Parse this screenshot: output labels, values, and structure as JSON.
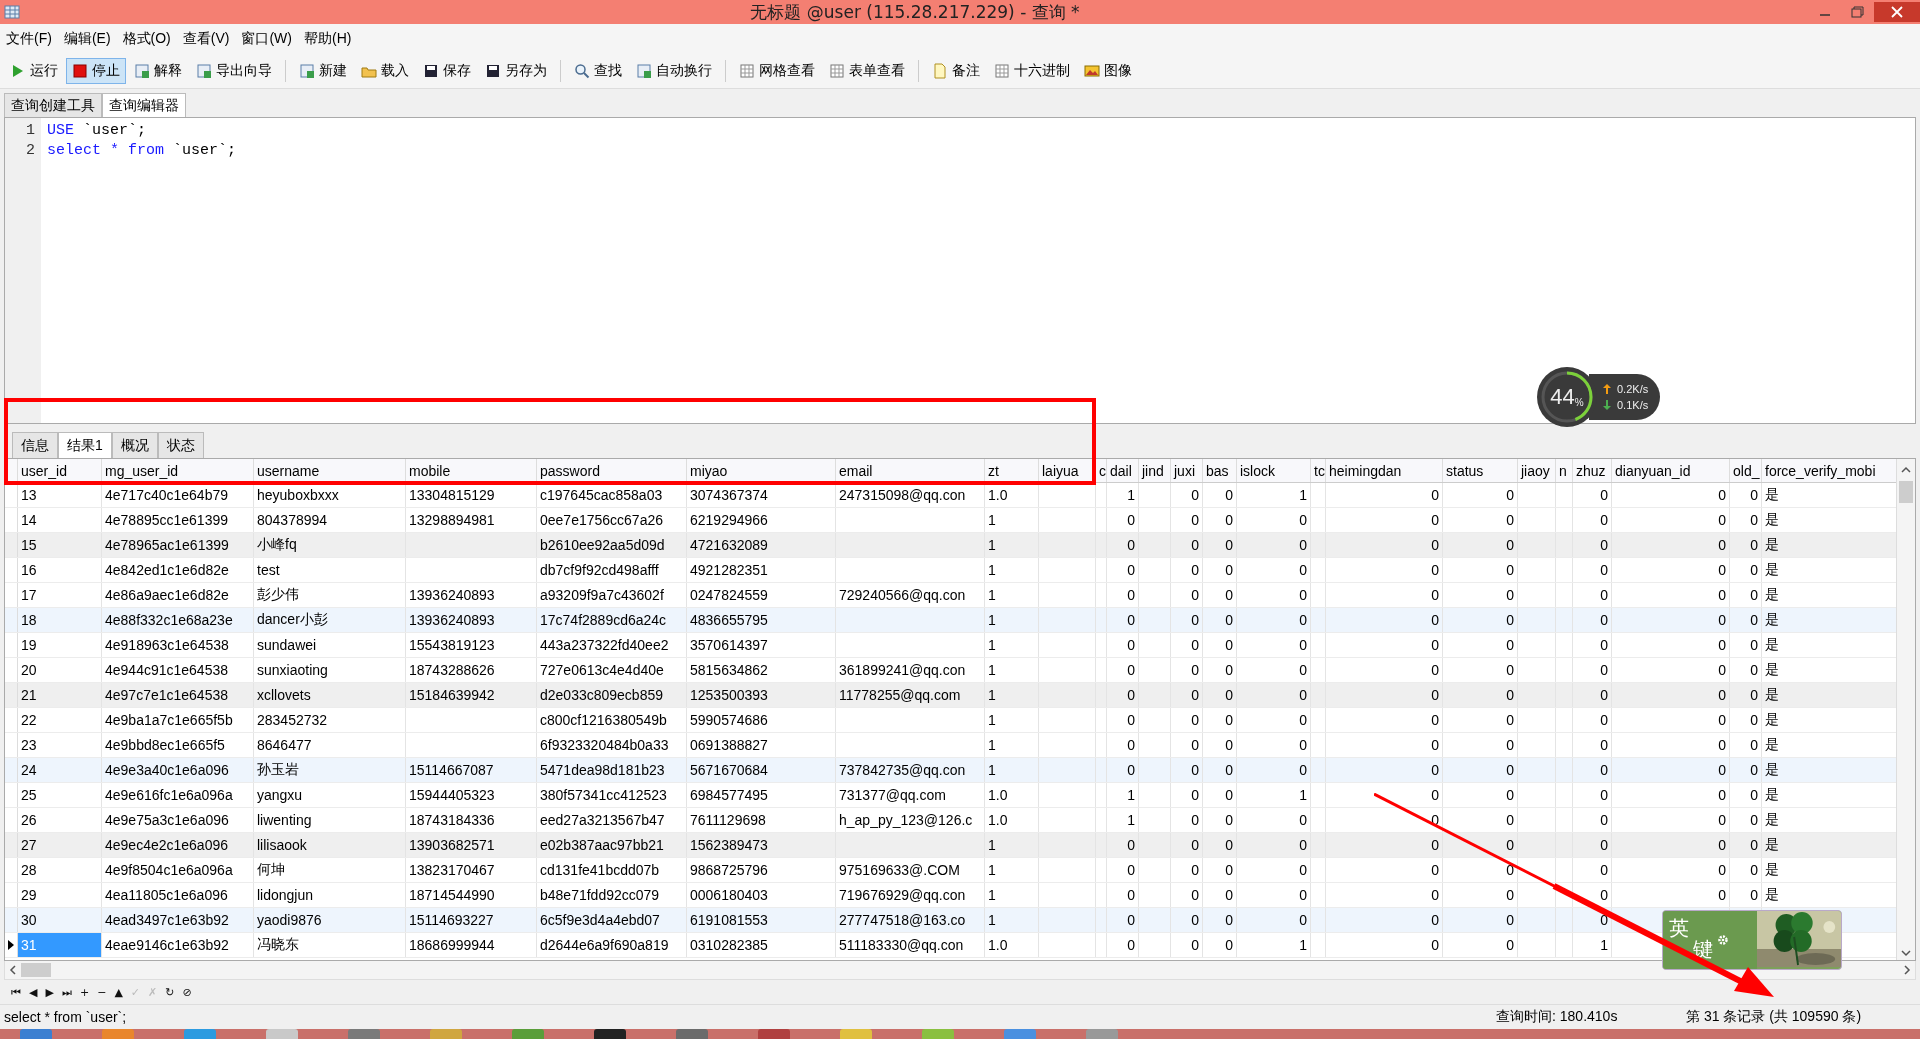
{
  "window": {
    "title": "无标题 @user (115.28.217.229) - 查询 *"
  },
  "menu": [
    "文件(F)",
    "编辑(E)",
    "格式(O)",
    "查看(V)",
    "窗口(W)",
    "帮助(H)"
  ],
  "toolbar": [
    [
      {
        "label": "运行",
        "selected": false
      },
      {
        "label": "停止",
        "selected": true
      },
      {
        "label": "解释",
        "selected": false
      },
      {
        "label": "导出向导",
        "selected": false
      }
    ],
    [
      {
        "label": "新建",
        "selected": false
      },
      {
        "label": "载入",
        "selected": false
      },
      {
        "label": "保存",
        "selected": false
      },
      {
        "label": "另存为",
        "selected": false
      }
    ],
    [
      {
        "label": "查找",
        "selected": false
      },
      {
        "label": "自动换行",
        "selected": false
      }
    ],
    [
      {
        "label": "网格查看",
        "selected": false
      },
      {
        "label": "表单查看",
        "selected": false
      }
    ],
    [
      {
        "label": "备注",
        "selected": false
      },
      {
        "label": "十六进制",
        "selected": false
      },
      {
        "label": "图像",
        "selected": false
      }
    ]
  ],
  "editor_tabs": [
    {
      "label": "查询创建工具",
      "selected": false
    },
    {
      "label": "查询编辑器",
      "selected": true
    }
  ],
  "editor": {
    "lines": [
      {
        "number": "1",
        "tokens": [
          {
            "text": "USE",
            "kind": "keyword"
          },
          {
            "text": " `user`;",
            "kind": "plain"
          }
        ]
      },
      {
        "number": "2",
        "tokens": [
          {
            "text": "select * from",
            "kind": "keyword"
          },
          {
            "text": " `user`;",
            "kind": "plain"
          }
        ]
      }
    ]
  },
  "result_tabs": [
    {
      "label": "信息",
      "selected": false
    },
    {
      "label": "结果1",
      "selected": true
    },
    {
      "label": "概况",
      "selected": false
    },
    {
      "label": "状态",
      "selected": false
    }
  ],
  "table": {
    "columns": [
      {
        "label": "user_id",
        "kind": "text"
      },
      {
        "label": "mg_user_id",
        "kind": "text"
      },
      {
        "label": "username",
        "kind": "text"
      },
      {
        "label": "mobile",
        "kind": "text"
      },
      {
        "label": "password",
        "kind": "text"
      },
      {
        "label": "miyao",
        "kind": "text"
      },
      {
        "label": "email",
        "kind": "text"
      },
      {
        "label": "zt",
        "kind": "text"
      },
      {
        "label": "laiyua",
        "kind": "text"
      },
      {
        "label": "c",
        "kind": "text"
      },
      {
        "label": "dail",
        "kind": "number"
      },
      {
        "label": "jind",
        "kind": "number"
      },
      {
        "label": "juxi",
        "kind": "number"
      },
      {
        "label": "bas",
        "kind": "number"
      },
      {
        "label": "islock",
        "kind": "number"
      },
      {
        "label": "tc",
        "kind": "number"
      },
      {
        "label": "heimingdan",
        "kind": "number"
      },
      {
        "label": "status",
        "kind": "number"
      },
      {
        "label": "jiaoy",
        "kind": "text"
      },
      {
        "label": "n",
        "kind": "text"
      },
      {
        "label": "zhuz",
        "kind": "number"
      },
      {
        "label": "dianyuan_id",
        "kind": "number"
      },
      {
        "label": "old_",
        "kind": "number"
      },
      {
        "label": "force_verify_mobi",
        "kind": "text"
      }
    ],
    "rows": [
      {
        "selected": false,
        "cells": [
          "13",
          "4e717c40c1e64b79",
          "heyuboxbxxx",
          "13304815129",
          "c197645cac858a03",
          "3074367374",
          "247315098@qq.con",
          "1.0",
          null,
          null,
          "1",
          null,
          "0",
          "0",
          "1",
          null,
          "0",
          "0",
          null,
          null,
          "0",
          "0",
          "0",
          "是"
        ]
      },
      {
        "selected": false,
        "cells": [
          "14",
          "4e78895cc1e61399",
          "804378994",
          "13298894981",
          "0ee7e1756cc67a26",
          "6219294966",
          null,
          "1",
          null,
          null,
          "0",
          null,
          "0",
          "0",
          "0",
          null,
          "0",
          "0",
          null,
          null,
          "0",
          "0",
          "0",
          "是"
        ]
      },
      {
        "selected": false,
        "cells": [
          "15",
          "4e78965ac1e61399",
          "小峰fq",
          null,
          "b2610ee92aa5d09d",
          "4721632089",
          null,
          "1",
          null,
          null,
          "0",
          null,
          "0",
          "0",
          "0",
          null,
          "0",
          "0",
          null,
          null,
          "0",
          "0",
          "0",
          "是"
        ]
      },
      {
        "selected": false,
        "cells": [
          "16",
          "4e842ed1c1e6d82e",
          "test",
          null,
          "db7cf9f92cd498afff",
          "4921282351",
          null,
          "1",
          null,
          null,
          "0",
          null,
          "0",
          "0",
          "0",
          null,
          "0",
          "0",
          null,
          null,
          "0",
          "0",
          "0",
          "是"
        ]
      },
      {
        "selected": false,
        "cells": [
          "17",
          "4e86a9aec1e6d82e",
          "彭少伟",
          "13936240893",
          "a93209f9a7c43602f",
          "0247824559",
          "729240566@qq.con",
          "1",
          null,
          null,
          "0",
          null,
          "0",
          "0",
          "0",
          null,
          "0",
          "0",
          null,
          null,
          "0",
          "0",
          "0",
          "是"
        ]
      },
      {
        "selected": false,
        "cells": [
          "18",
          "4e88f332c1e68a23e",
          "dancer小彭",
          "13936240893",
          "17c74f2889cd6a24c",
          "4836655795",
          null,
          "1",
          null,
          null,
          "0",
          null,
          "0",
          "0",
          "0",
          null,
          "0",
          "0",
          null,
          null,
          "0",
          "0",
          "0",
          "是"
        ]
      },
      {
        "selected": false,
        "cells": [
          "19",
          "4e918963c1e64538",
          "sundawei",
          "15543819123",
          "443a237322fd40ee2",
          "3570614397",
          null,
          "1",
          null,
          null,
          "0",
          null,
          "0",
          "0",
          "0",
          null,
          "0",
          "0",
          null,
          null,
          "0",
          "0",
          "0",
          "是"
        ]
      },
      {
        "selected": false,
        "cells": [
          "20",
          "4e944c91c1e64538",
          "sunxiaoting",
          "18743288626",
          "727e0613c4e4d40e",
          "5815634862",
          "361899241@qq.con",
          "1",
          null,
          null,
          "0",
          null,
          "0",
          "0",
          "0",
          null,
          "0",
          "0",
          null,
          null,
          "0",
          "0",
          "0",
          "是"
        ]
      },
      {
        "selected": false,
        "cells": [
          "21",
          "4e97c7e1c1e64538",
          "xcllovets",
          "15184639942",
          "d2e033c809ecb859",
          "1253500393",
          "11778255@qq.com",
          "1",
          null,
          null,
          "0",
          null,
          "0",
          "0",
          "0",
          null,
          "0",
          "0",
          null,
          null,
          "0",
          "0",
          "0",
          "是"
        ]
      },
      {
        "selected": false,
        "cells": [
          "22",
          "4e9ba1a7c1e665f5b",
          "283452732",
          null,
          "c800cf1216380549b",
          "5990574686",
          null,
          "1",
          null,
          null,
          "0",
          null,
          "0",
          "0",
          "0",
          null,
          "0",
          "0",
          null,
          null,
          "0",
          "0",
          "0",
          "是"
        ]
      },
      {
        "selected": false,
        "cells": [
          "23",
          "4e9bbd8ec1e665f5",
          "8646477",
          null,
          "6f9323320484b0a33",
          "0691388827",
          null,
          "1",
          null,
          null,
          "0",
          null,
          "0",
          "0",
          "0",
          null,
          "0",
          "0",
          null,
          null,
          "0",
          "0",
          "0",
          "是"
        ]
      },
      {
        "selected": false,
        "cells": [
          "24",
          "4e9e3a40c1e6a096",
          "孙玉岩",
          "15114667087",
          "5471dea98d181b23",
          "5671670684",
          "737842735@qq.con",
          "1",
          null,
          null,
          "0",
          null,
          "0",
          "0",
          "0",
          null,
          "0",
          "0",
          null,
          null,
          "0",
          "0",
          "0",
          "是"
        ]
      },
      {
        "selected": false,
        "cells": [
          "25",
          "4e9e616fc1e6a096a",
          "yangxu",
          "15944405323",
          "380f57341cc412523",
          "6984577495",
          "731377@qq.com",
          "1.0",
          null,
          null,
          "1",
          null,
          "0",
          "0",
          "1",
          null,
          "0",
          "0",
          null,
          null,
          "0",
          "0",
          "0",
          "是"
        ]
      },
      {
        "selected": false,
        "cells": [
          "26",
          "4e9e75a3c1e6a096",
          "liwenting",
          "18743184336",
          "eed27a3213567b47",
          "7611129698",
          "h_ap_py_123@126.c",
          "1.0",
          null,
          null,
          "1",
          null,
          "0",
          "0",
          "0",
          null,
          "0",
          "0",
          null,
          null,
          "0",
          "0",
          "0",
          "是"
        ]
      },
      {
        "selected": false,
        "cells": [
          "27",
          "4e9ec4e2c1e6a096",
          "lilisaook",
          "13903682571",
          "e02b387aac97bb21",
          "1562389473",
          null,
          "1",
          null,
          null,
          "0",
          null,
          "0",
          "0",
          "0",
          null,
          "0",
          "0",
          null,
          null,
          "0",
          "0",
          "0",
          "是"
        ]
      },
      {
        "selected": false,
        "cells": [
          "28",
          "4e9f8504c1e6a096a",
          "何坤",
          "13823170467",
          "cd131fe41bcdd07b",
          "9868725796",
          "975169633@.COM",
          "1",
          null,
          null,
          "0",
          null,
          "0",
          "0",
          "0",
          null,
          "0",
          "0",
          null,
          null,
          "0",
          "0",
          "0",
          "是"
        ]
      },
      {
        "selected": false,
        "cells": [
          "29",
          "4ea11805c1e6a096",
          "lidongjun",
          "18714544990",
          "b48e71fdd92cc079",
          "0006180403",
          "719676929@qq.con",
          "1",
          null,
          null,
          "0",
          null,
          "0",
          "0",
          "0",
          null,
          "0",
          "0",
          null,
          null,
          "0",
          "0",
          "0",
          "是"
        ]
      },
      {
        "selected": false,
        "cells": [
          "30",
          "4ead3497c1e63b92",
          "yaodi9876",
          "15114693227",
          "6c5f9e3d4a4ebd07",
          "6191081553",
          "277747518@163.co",
          "1",
          null,
          null,
          "0",
          null,
          "0",
          "0",
          "0",
          null,
          "0",
          "0",
          null,
          null,
          "0",
          null,
          null,
          null
        ]
      },
      {
        "selected": true,
        "cells": [
          "31",
          "4eae9146c1e63b92",
          "冯晓东",
          "18686999944",
          "d2644e6a9f690a819",
          "0310282385",
          "511183330@qq.con",
          "1.0",
          null,
          null,
          "0",
          null,
          "0",
          "0",
          "1",
          null,
          "0",
          "0",
          null,
          null,
          "1",
          null,
          null,
          null
        ]
      }
    ]
  },
  "nav_buttons": [
    {
      "text": "⏮",
      "disabled": false
    },
    {
      "text": "◀",
      "disabled": false
    },
    {
      "text": "▶",
      "disabled": false
    },
    {
      "text": "⏭",
      "disabled": false
    },
    {
      "text": "+",
      "disabled": false
    },
    {
      "text": "−",
      "disabled": false
    },
    {
      "text": "▲",
      "disabled": false
    },
    {
      "text": "✓",
      "disabled": true
    },
    {
      "text": "✗",
      "disabled": true
    },
    {
      "text": "↻",
      "disabled": false
    },
    {
      "text": "⊘",
      "disabled": false
    }
  ],
  "status_bar": {
    "query": "select * from `user`;",
    "time": "查询时间: 180.410s",
    "record": "第 31 条记录 (共 109590 条)"
  },
  "net_monitor": {
    "percent": "44",
    "unit": "%",
    "level": 0.44,
    "up": "0.2K/s",
    "down": "0.1K/s"
  },
  "ime": {
    "mode": "英",
    "label": "键"
  }
}
